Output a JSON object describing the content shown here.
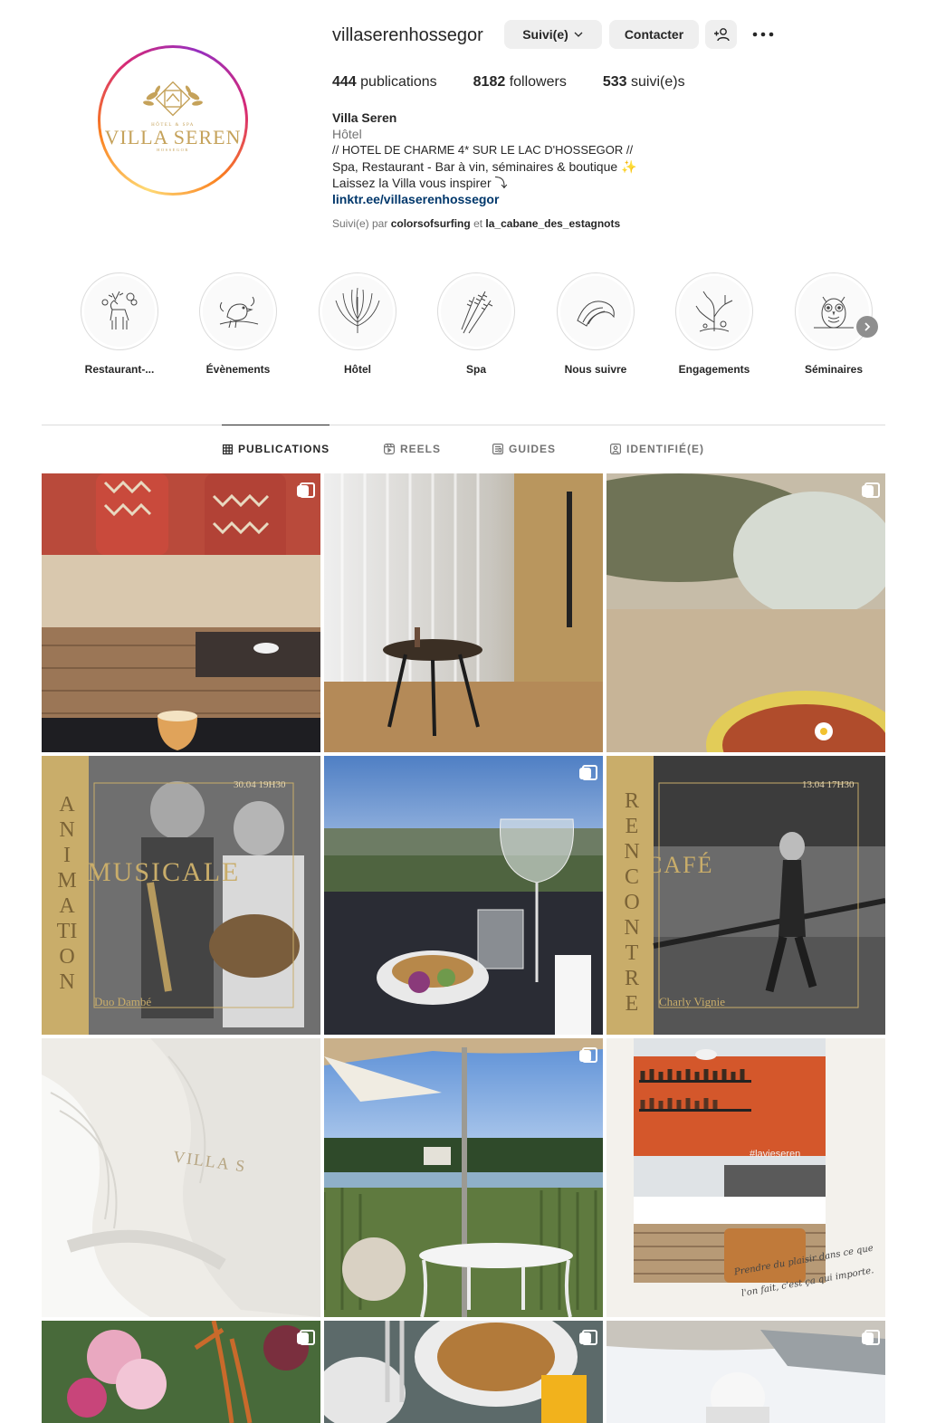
{
  "profile": {
    "username": "villaserenhossegor",
    "logo": {
      "small_text": "HÔTEL & SPA",
      "big_text": "VILLA SEREN",
      "tiny_text": "HOSSEGOR"
    },
    "buttons": {
      "follow": "Suivi(e)",
      "contact": "Contacter"
    },
    "stats": {
      "posts_count": "444",
      "posts_label": "publications",
      "followers_count": "8182",
      "followers_label": "followers",
      "following_count": "533",
      "following_label": "suivi(e)s"
    },
    "bio": {
      "name": "Villa Seren",
      "category": "Hôtel",
      "line1": "// HOTEL DE CHARME 4* SUR LE LAC D'HOSSEGOR //",
      "line2": "Spa, Restaurant - Bar à vin, séminaires & boutique ✨",
      "line3": "Laissez la Villa vous inspirer ⤵",
      "link": "linktr.ee/villaserenhossegor"
    },
    "followed_by": {
      "prefix": "Suivi(e) par",
      "user1": "colorsofsurfing",
      "joiner": "et",
      "user2": "la_cabane_des_estagnots"
    }
  },
  "highlights": [
    {
      "label": "Restaurant-...",
      "icon": "deer-icon"
    },
    {
      "label": "Évènements",
      "icon": "bird-icon"
    },
    {
      "label": "Hôtel",
      "icon": "palm-leaf-icon"
    },
    {
      "label": "Spa",
      "icon": "wheat-icon"
    },
    {
      "label": "Nous suivre",
      "icon": "wave-icon"
    },
    {
      "label": "Engagements",
      "icon": "coral-icon"
    },
    {
      "label": "Séminaires",
      "icon": "owl-icon"
    }
  ],
  "tabs": [
    {
      "label": "PUBLICATIONS",
      "icon": "grid-icon"
    },
    {
      "label": "REELS",
      "icon": "reels-icon"
    },
    {
      "label": "GUIDES",
      "icon": "guides-icon"
    },
    {
      "label": "IDENTIFIÉ(E)",
      "icon": "tagged-icon"
    }
  ],
  "posts": [
    {
      "alt": "terrasse cocktail",
      "multi": true
    },
    {
      "alt": "chambre table",
      "multi": false
    },
    {
      "alt": "plat fleurs",
      "multi": true
    },
    {
      "alt": "animation musicale",
      "multi": false,
      "overlay": {
        "vertical": "ANIMATION",
        "title": "MUSICALE",
        "date": "30.04 19H30",
        "caption": "Duo Dambé"
      }
    },
    {
      "alt": "plat lac",
      "multi": true
    },
    {
      "alt": "rencontre café",
      "multi": false,
      "overlay": {
        "vertical": "RENCONTRE",
        "title": "CAFÉ",
        "date": "13.04 17H30",
        "caption": "Charly Vignie"
      }
    },
    {
      "alt": "peignoir",
      "multi": false,
      "overlay": {
        "brand": "VILLA S"
      }
    },
    {
      "alt": "terrasse lac",
      "multi": true
    },
    {
      "alt": "bar",
      "multi": false,
      "overlay": {
        "tag": "#lavieseren",
        "quote1": "Prendre du plaisir dans ce que",
        "quote2": "l'on fait, c'est ça qui importe."
      }
    },
    {
      "alt": "fleurs",
      "multi": true
    },
    {
      "alt": "brunch",
      "multi": true
    },
    {
      "alt": "spa",
      "multi": true
    }
  ],
  "colors": {
    "accent_link": "#00376b",
    "gold": "#c5a25a",
    "button_bg": "#efefef",
    "text": "#262626",
    "muted": "#737373"
  }
}
